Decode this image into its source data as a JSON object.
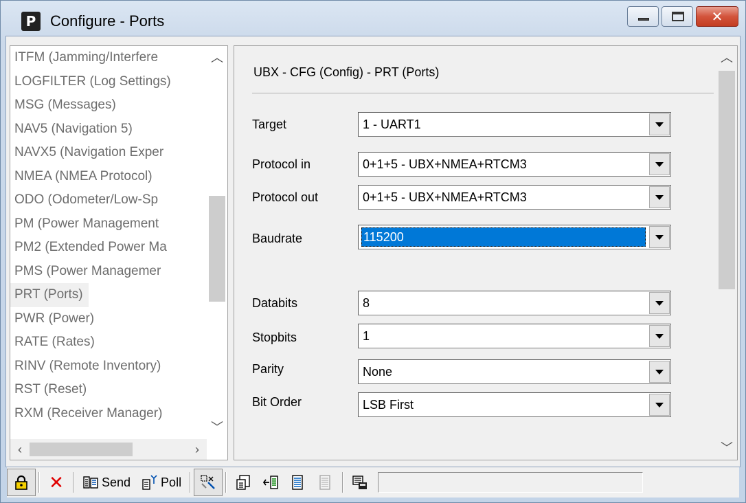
{
  "window": {
    "title": "Configure - Ports",
    "app_icon_letter": "P"
  },
  "left_list": {
    "items": [
      "ITFM (Jamming/Interfere",
      "LOGFILTER (Log Settings)",
      "MSG (Messages)",
      "NAV5 (Navigation 5)",
      "NAVX5 (Navigation Exper",
      "NMEA (NMEA Protocol)",
      "ODO (Odometer/Low-Sp",
      "PM (Power Management",
      "PM2 (Extended Power Ma",
      "PMS (Power Managemer",
      "PRT (Ports)",
      "PWR (Power)",
      "RATE (Rates)",
      "RINV (Remote Inventory)",
      "RST (Reset)",
      "RXM (Receiver Manager)"
    ],
    "selected_index": 10
  },
  "panel": {
    "heading": "UBX - CFG (Config) - PRT (Ports)",
    "fields": [
      {
        "label": "Target",
        "value": "1 - UART1"
      },
      {
        "label": "Protocol in",
        "value": "0+1+5 - UBX+NMEA+RTCM3"
      },
      {
        "label": "Protocol out",
        "value": "0+1+5 - UBX+NMEA+RTCM3"
      },
      {
        "label": "Baudrate",
        "value": "115200"
      },
      {
        "label": "Databits",
        "value": "8"
      },
      {
        "label": "Stopbits",
        "value": "1"
      },
      {
        "label": "Parity",
        "value": "None"
      },
      {
        "label": "Bit Order",
        "value": "LSB First"
      }
    ]
  },
  "toolbar": {
    "send_label": "Send",
    "poll_label": "Poll",
    "status_text": ""
  },
  "icons": {
    "lock": "lock-icon",
    "delete": "delete-x-icon",
    "send": "send-icon",
    "poll": "poll-icon",
    "autopoll": "auto-poll-icon",
    "load": "load-icon",
    "store": "store-icon",
    "revert": "revert-icon",
    "print": "print-icon"
  },
  "colors": {
    "selection": "#0078d7",
    "close_button": "#c33d21",
    "delete_x": "#e00000"
  }
}
